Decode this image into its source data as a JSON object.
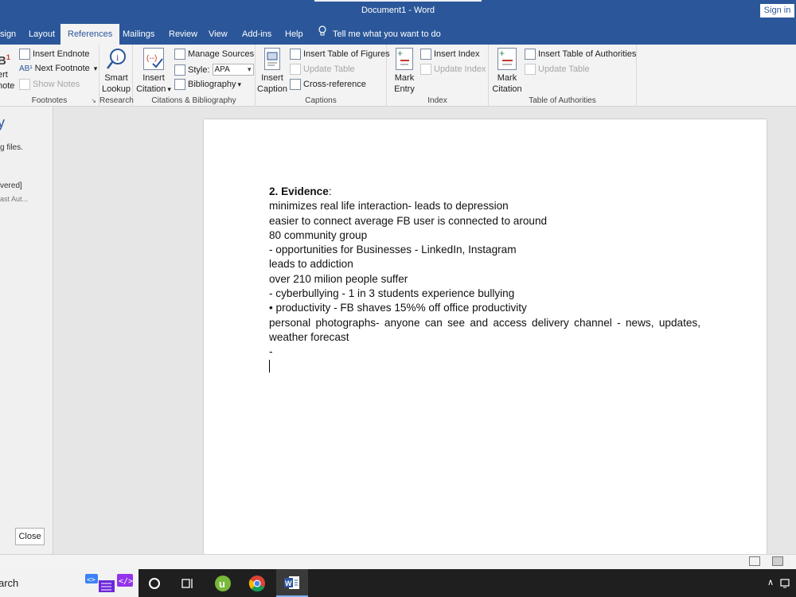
{
  "window": {
    "title": "Document1  -  Word",
    "signin": "Sign in"
  },
  "tabs": [
    {
      "label": "sign",
      "active": false
    },
    {
      "label": "Layout",
      "active": false
    },
    {
      "label": "References",
      "active": true
    },
    {
      "label": "Mailings",
      "active": false
    },
    {
      "label": "Review",
      "active": false
    },
    {
      "label": "View",
      "active": false
    },
    {
      "label": "Add-ins",
      "active": false
    },
    {
      "label": "Help",
      "active": false
    }
  ],
  "tell_me": "Tell me what you want to do",
  "ribbon": {
    "footnotes": {
      "insert_endnote": "Insert Endnote",
      "next_footnote": "Next Footnote",
      "show_notes": "Show Notes",
      "insert_partial_top": "ert",
      "insert_partial_bottom": "note",
      "label": "Footnotes"
    },
    "research": {
      "top": "Smart",
      "bottom": "Lookup",
      "label": "Research"
    },
    "citations": {
      "insert_top": "Insert",
      "insert_bottom": "Citation",
      "manage_sources": "Manage Sources",
      "style_label": "Style:",
      "style_value": "APA",
      "bibliography": "Bibliography",
      "label": "Citations & Bibliography"
    },
    "captions": {
      "insert_top": "Insert",
      "insert_bottom": "Caption",
      "insert_tof": "Insert Table of Figures",
      "update_table": "Update Table",
      "cross_reference": "Cross-reference",
      "label": "Captions"
    },
    "index": {
      "mark_top": "Mark",
      "mark_bottom": "Entry",
      "insert_index": "Insert Index",
      "update_index": "Update Index",
      "label": "Index"
    },
    "toa": {
      "mark_top": "Mark",
      "mark_bottom": "Citation",
      "insert_toa": "Insert Table of Authorities",
      "update_table": "Update Table",
      "label": "Table of Authorities"
    }
  },
  "side_pane": {
    "heading_fragment": "y",
    "text1": "g files.",
    "text2": "vered]",
    "text3": "ast Aut...",
    "close": "Close"
  },
  "document": {
    "heading": "2. Evidence",
    "heading_colon": ":",
    "lines": [
      "minimizes real life interaction- leads to depression",
      "easier to connect average FB user is connected to around",
      "80 community group",
      "- opportunities for Businesses - LinkedIn, Instagram",
      "leads to addiction",
      "over 210 milion people suffer",
      "- cyberbullying - 1 in 3 students experience bullying",
      "• productivity - FB shaves 15%% off office productivity"
    ],
    "last_paragraph": "personal photographs- anyone can see and access delivery channel - news, updates, weather forecast",
    "dash": "-"
  },
  "taskbar": {
    "search_text": "arch"
  }
}
